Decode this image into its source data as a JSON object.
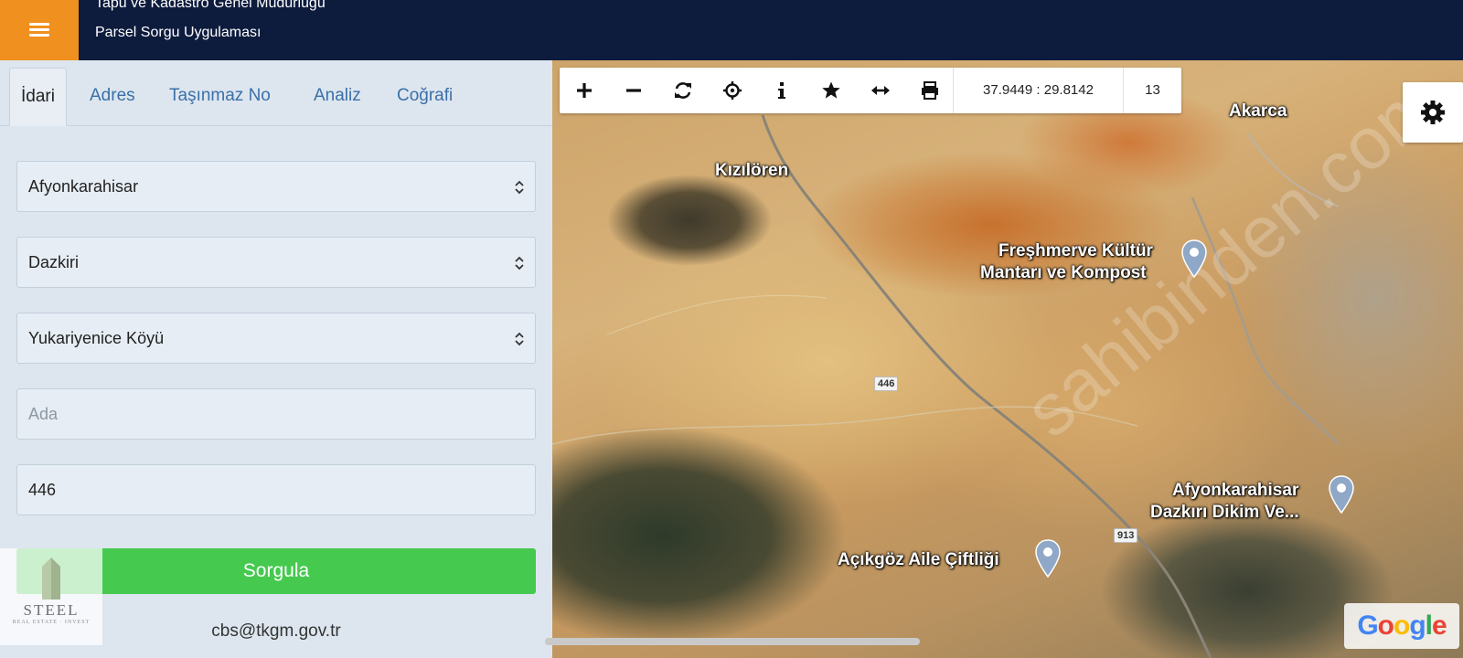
{
  "header": {
    "title": "Tapu ve Kadastro Genel Müdürlüğü",
    "subtitle": "Parsel Sorgu Uygulaması",
    "menu_icon": "hamburger-icon",
    "colors": {
      "bar": "#0d1b3d",
      "menu": "#f0901e"
    }
  },
  "tabs": [
    {
      "label": "İdari",
      "active": true
    },
    {
      "label": "Adres",
      "active": false
    },
    {
      "label": "Taşınmaz No",
      "active": false
    },
    {
      "label": "Analiz",
      "active": false
    },
    {
      "label": "Coğrafi",
      "active": false
    }
  ],
  "form": {
    "province": "Afyonkarahisar",
    "district": "Dazkiri",
    "neighborhood": "Yukariyenice Köyü",
    "ada_placeholder": "Ada",
    "ada_value": "",
    "parsel_value": "446",
    "query_button": "Sorgula"
  },
  "footer": {
    "email": "cbs@tkgm.gov.tr"
  },
  "logo": {
    "name": "STEEL",
    "tagline": "REAL ESTATE · INVEST"
  },
  "map": {
    "toolbar": {
      "tools": [
        "zoom-in-icon",
        "zoom-out-icon",
        "refresh-icon",
        "locate-icon",
        "info-icon",
        "favorite-icon",
        "measure-icon",
        "print-icon"
      ],
      "coordinates": "37.9449 : 29.8142",
      "zoom": "13"
    },
    "labels": {
      "kizil": "Kızılören",
      "akarca": "Akarca",
      "fresh_1": "Freşhmerve Kültür",
      "fresh_2": "Mantarı ve Kompost",
      "dikim_1": "Afyonkarahisar",
      "dikim_2": "Dazkırı Dikim Ve...",
      "aile": "Açıkgöz Aile Çiftliği"
    },
    "roads": {
      "r446": "446",
      "r913": "913"
    },
    "watermark": "sahibinden.com",
    "attribution": "Google"
  }
}
